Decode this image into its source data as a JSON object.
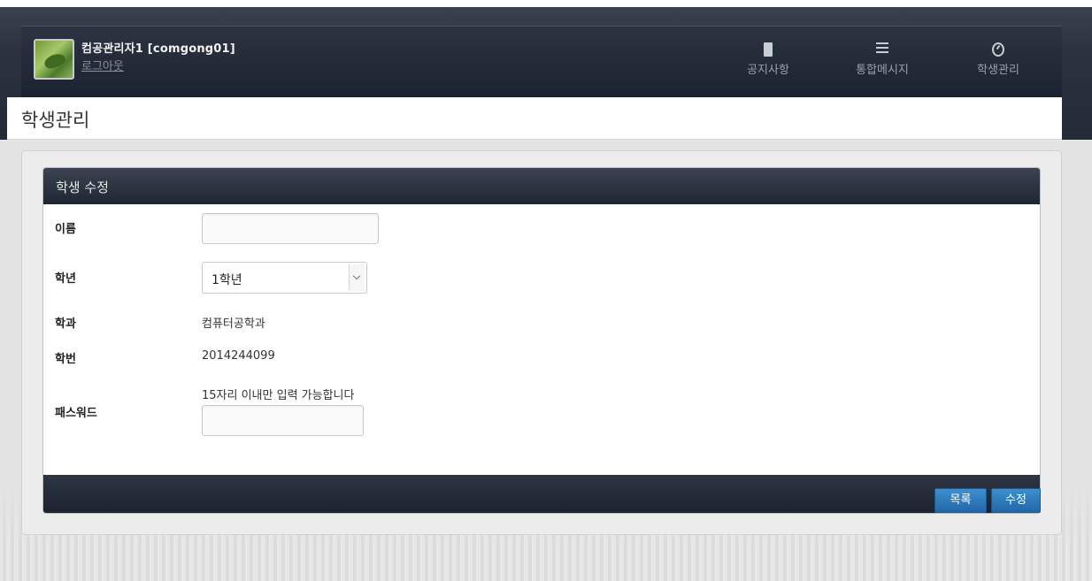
{
  "header": {
    "user_name": "컴공관리자1 [comgong01]",
    "logout_label": "로그아웃",
    "nav": [
      {
        "label": "공지사항",
        "icon": "notice-icon"
      },
      {
        "label": "통합메시지",
        "icon": "list-icon"
      },
      {
        "label": "학생관리",
        "icon": "dashboard-icon"
      }
    ]
  },
  "page": {
    "title": "학생관리"
  },
  "form": {
    "title": "학생 수정",
    "name_label": "이름",
    "name_value": "",
    "grade_label": "학년",
    "grade_selected": "1학년",
    "dept_label": "학과",
    "dept_value": "컴퓨터공학과",
    "sid_label": "학번",
    "sid_value": "2014244099",
    "pw_label": "패스워드",
    "pw_hint": "15자리 이내만 입력 가능합니다",
    "pw_value": ""
  },
  "buttons": {
    "list_label": "목록",
    "edit_label": "수정"
  },
  "colors": {
    "header_bg": "#1f2633",
    "button_blue": "#2f7bc0"
  }
}
